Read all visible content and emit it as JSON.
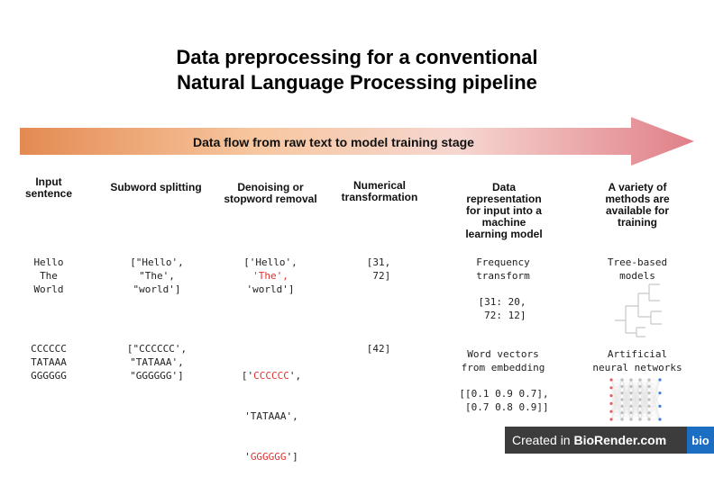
{
  "title_line1": "Data preprocessing for a conventional",
  "title_line2": "Natural Language Processing pipeline",
  "arrow_label": "Data flow from raw text to model training stage",
  "headers": {
    "input": "Input\nsentence",
    "subword": "Subword splitting",
    "denoise": "Denoising or\nstopword removal",
    "numerical": "Numerical\ntransformation",
    "representation": "Data\nrepresentation\nfor input into a\nmachine\nlearning model",
    "methods": "A variety of\nmethods are\navailable for\ntraining"
  },
  "row1": {
    "input": [
      "Hello",
      "The",
      "World"
    ],
    "subword": [
      "[\"Hello',",
      "\"The',",
      "\"world']"
    ],
    "denoise": {
      "l1": "['Hello',",
      "l2": "'The',",
      "l3": "'world']"
    },
    "numerical": [
      "[31,",
      " 72]"
    ],
    "rep_a": [
      "Frequency",
      "transform"
    ],
    "rep_b": [
      "[31: 20,",
      " 72: 12]"
    ],
    "method": [
      "Tree-based",
      "models"
    ]
  },
  "row2": {
    "input": [
      "CCCCCC",
      "TATAAA",
      "GGGGGG"
    ],
    "subword": [
      "[\"CCCCCC',",
      "\"TATAAA',",
      "\"GGGGGG']"
    ],
    "denoise": {
      "l1_pre": "['",
      "l1_red": "CCCCCC",
      "l1_post": "',",
      "l2": "'TATAAA',",
      "l3_pre": "'",
      "l3_red": "GGGGGG",
      "l3_post": "']"
    },
    "numerical": "[42]",
    "rep_a": [
      "Word vectors",
      "from embedding"
    ],
    "rep_b": [
      "[[0.1 0.9 0.7],",
      " [0.7 0.8 0.9]]"
    ],
    "method": [
      "Artificial",
      "neural networks"
    ]
  },
  "footer": {
    "prefix": "Created in ",
    "brand": "BioRender.com",
    "logo": "bio"
  },
  "colors": {
    "arrow_start": "#e8935a",
    "arrow_mid": "#f6c9a8",
    "arrow_end": "#e07f88",
    "highlight": "#e0332f",
    "footer_bg": "#3c3c3c",
    "logo_bg": "#1b6ec2"
  }
}
